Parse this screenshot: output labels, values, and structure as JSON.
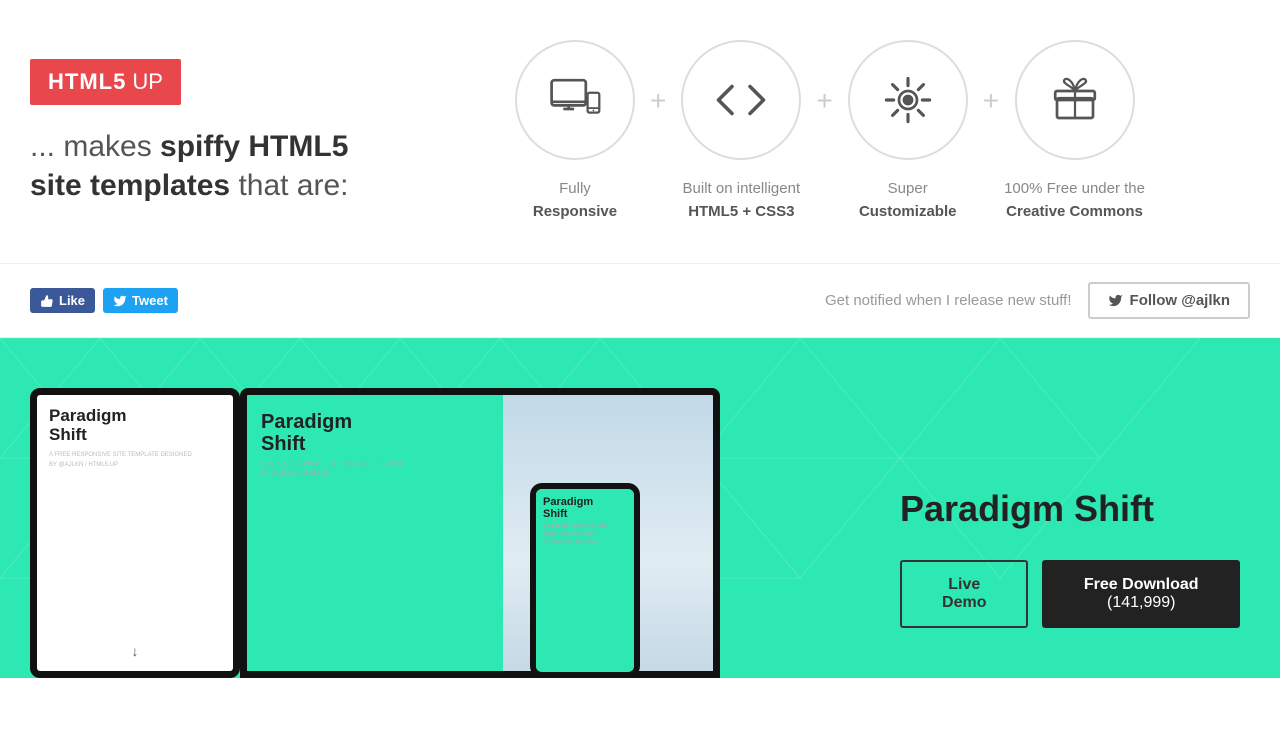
{
  "logo": {
    "html5": "HTML5",
    "up": "UP"
  },
  "tagline": {
    "prefix": "... makes",
    "bold": "spiffy HTML5",
    "middle": "site templates",
    "suffix": "that are:"
  },
  "features": [
    {
      "id": "responsive",
      "icon": "monitor-mobile",
      "label_normal": "Fully",
      "label_bold": "Responsive"
    },
    {
      "id": "html5css3",
      "icon": "code",
      "label_normal": "Built on intelligent",
      "label_bold": "HTML5 + CSS3"
    },
    {
      "id": "customizable",
      "icon": "gear",
      "label_normal": "Super",
      "label_bold": "Customizable"
    },
    {
      "id": "free",
      "icon": "gift",
      "label_normal": "100% Free under the",
      "label_bold": "Creative Commons"
    }
  ],
  "social": {
    "like_label": "Like",
    "tweet_label": "Tweet",
    "notify_text": "Get notified when I release new stuff!",
    "follow_label": "Follow @ajlkn"
  },
  "template": {
    "title": "Paradigm Shift",
    "live_demo_label": "Live Demo",
    "free_download_label": "Free Download",
    "download_count": "(141,999)"
  },
  "mockup": {
    "title_line1": "Paradigm",
    "title_line2": "Shift",
    "subtitle": "A FREE RESPONSIVE SITE TEMPLATE DESIGNED\nBY @AJLKN / HTML5.UP"
  }
}
